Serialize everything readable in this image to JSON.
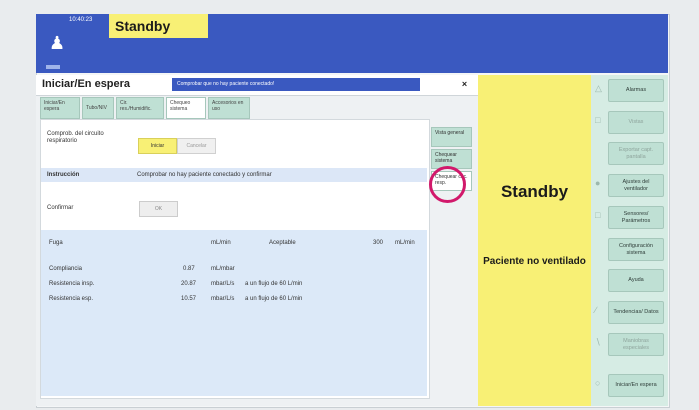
{
  "topbar": {
    "time": "10:40:23",
    "mode": "Standby",
    "person_icon": "person-icon",
    "bg": "#3a59c0"
  },
  "dialog": {
    "title": "Iniciar/En espera",
    "message": "Comprobar que no hay paciente conectado!",
    "close": "×",
    "tabs": [
      "Iniciar/En espera",
      "Tubo/NIV",
      "Cir. res./Humidific.",
      "Chequeo sistema",
      "Accesorios en uso"
    ],
    "check_label": "Comprob. del circuito respiratorio",
    "start_button": "Iniciar",
    "cancel_button": "Cancelar",
    "instruction_label": "Instrucción",
    "instruction_text": "Comprobar no hay paciente conectado y confirmar",
    "confirm_label": "Confirmar",
    "ok_button": "OK",
    "results": {
      "leak": {
        "label": "Fuga",
        "unit": "mL/min",
        "status": "Aceptable",
        "value": "300",
        "value_unit": "mL/min"
      },
      "rows": [
        {
          "label": "Compliancia",
          "value": "0.87",
          "unit": "mL/mbar",
          "note": ""
        },
        {
          "label": "Resistencia insp.",
          "value": "20.87",
          "unit": "mbar/L/s",
          "note": "a un flujo de 60 L/min"
        },
        {
          "label": "Resistencia esp.",
          "value": "10.57",
          "unit": "mbar/L/s",
          "note": "a un flujo de 60 L/min"
        }
      ]
    },
    "side_tabs": [
      "Vista general",
      "Chequear sistema",
      "Chequear circ. resp."
    ]
  },
  "standby_panel": {
    "title": "Standby",
    "subtitle": "Paciente no ventilado",
    "color": "#f8f075"
  },
  "right_buttons": [
    {
      "label": "Alarmas",
      "icon": "bell-icon",
      "enabled": true
    },
    {
      "label": "Vistas",
      "icon": "views-icon",
      "enabled": false
    },
    {
      "label": "Exportar capt. pantalla",
      "icon": "",
      "enabled": false
    },
    {
      "label": "Ajustes del ventilador",
      "icon": "settings-icon",
      "enabled": true
    },
    {
      "label": "Sensores/ Parámetros",
      "icon": "sensor-icon",
      "enabled": true
    },
    {
      "label": "Configuración sistema",
      "icon": "",
      "enabled": true
    },
    {
      "label": "Ayuda",
      "icon": "",
      "enabled": true
    },
    {
      "label": "Tendencias/ Datos",
      "icon": "trend-icon",
      "enabled": true
    },
    {
      "label": "Maniobras especiales",
      "icon": "maneuver-icon",
      "enabled": false
    },
    {
      "label": "Iniciar/En espera",
      "icon": "power-icon",
      "enabled": true
    }
  ]
}
